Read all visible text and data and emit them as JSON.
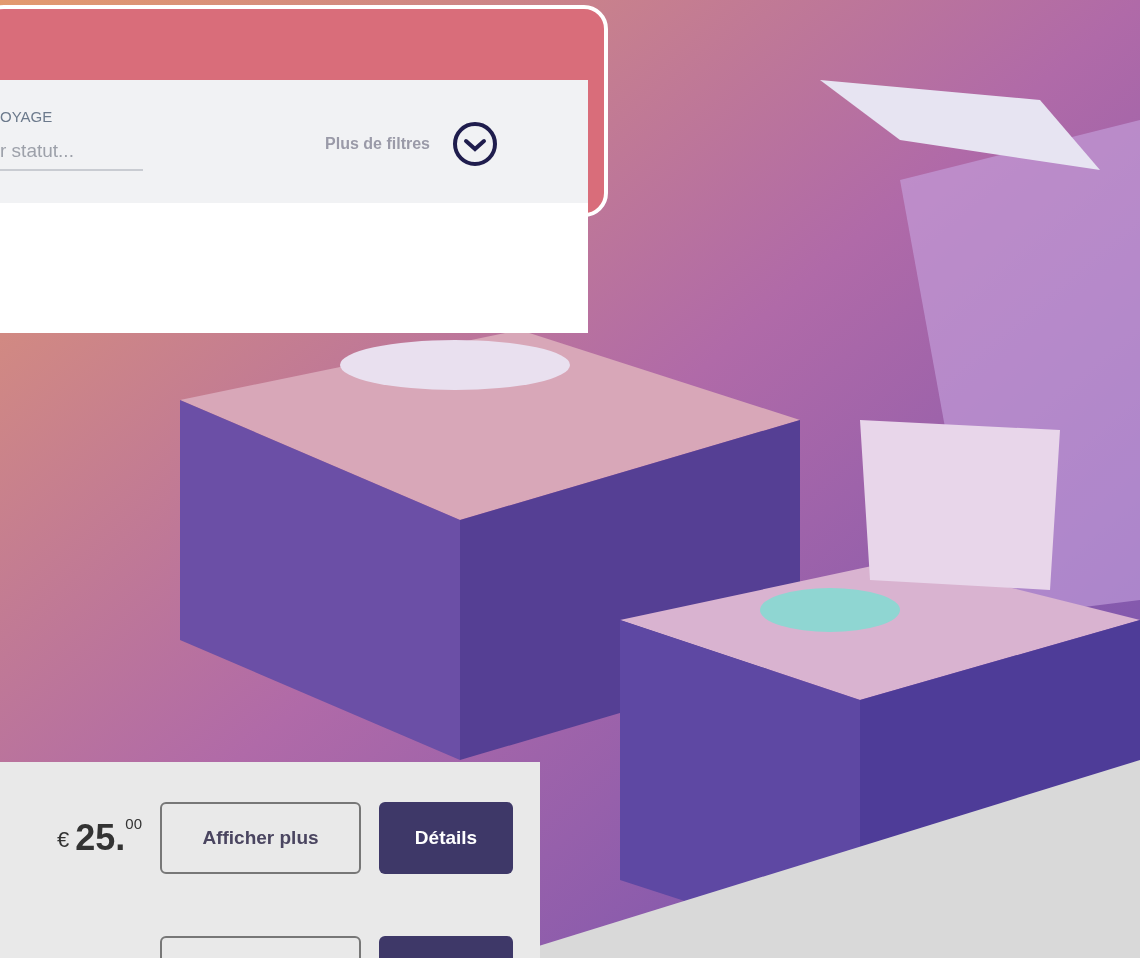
{
  "filter_panel": {
    "field_label": "OYAGE",
    "field_placeholder": "r statut...",
    "more_filters": "Plus de filtres"
  },
  "results": [
    {
      "kind": "full",
      "currency": "€",
      "price_whole": "25.",
      "price_cents": "00",
      "more_button": "Afficher plus",
      "details_button": "Détails"
    },
    {
      "kind": "cut"
    }
  ]
}
